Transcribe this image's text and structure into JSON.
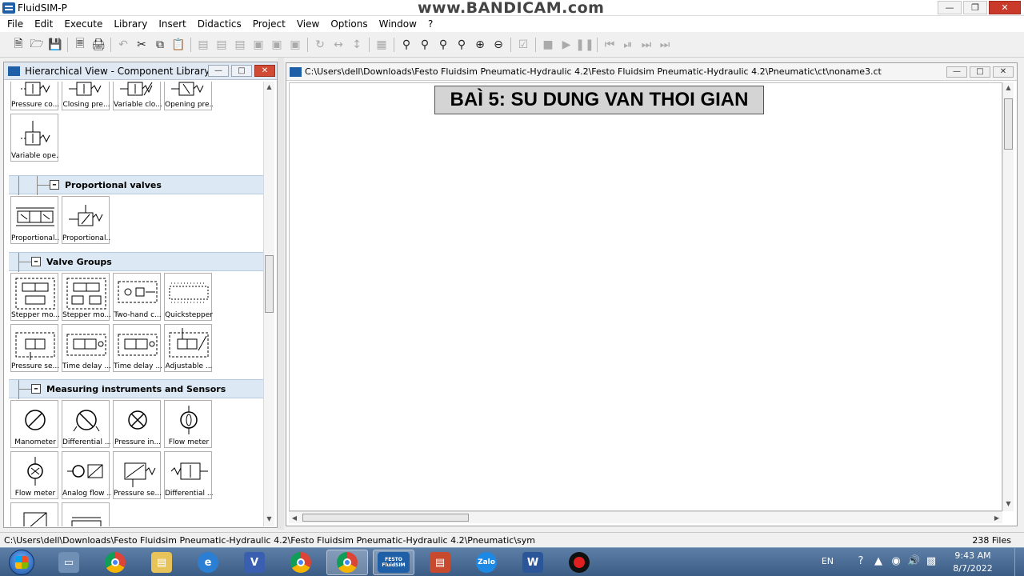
{
  "window": {
    "title": "FluidSIM-P",
    "watermark": "www.BANDICAM.com"
  },
  "menu": [
    "File",
    "Edit",
    "Execute",
    "Library",
    "Insert",
    "Didactics",
    "Project",
    "View",
    "Options",
    "Window",
    "?"
  ],
  "library": {
    "title": "Hierarchical View - Component Library",
    "top_items": [
      "Pressure co...",
      "Closing pre...",
      "Variable clo...",
      "Opening pre...",
      "Variable ope..."
    ],
    "categories": [
      {
        "label": "Proportional valves",
        "items": [
          "Proportional...",
          "Proportional..."
        ]
      },
      {
        "label": "Valve Groups",
        "items": [
          "Stepper mo...",
          "Stepper mo...",
          "Two-hand c...",
          "Quickstepper",
          "Pressure se...",
          "Time delay ...",
          "Time delay ...",
          "Adjustable ..."
        ]
      },
      {
        "label": "Measuring instruments and Sensors",
        "items": [
          "Manometer",
          "Differential ...",
          "Pressure in...",
          "Flow meter",
          "Flow meter",
          "Analog flow ...",
          "Pressure se...",
          "Differential ..."
        ]
      }
    ]
  },
  "circuit": {
    "path": "C:\\Users\\dell\\Downloads\\Festo Fluidsim Pneumatic-Hydraulic 4.2\\Festo Fluidsim Pneumatic-Hydraulic 4.2\\Pneumatic\\ct\\noname3.ct",
    "heading": "BAÌ 5: SU DUNG VAN THOI GIAN"
  },
  "status": {
    "path": "C:\\Users\\dell\\Downloads\\Festo Fluidsim Pneumatic-Hydraulic 4.2\\Festo Fluidsim Pneumatic-Hydraulic 4.2\\Pneumatic\\sym",
    "count": "238 Files"
  },
  "taskbar": {
    "lang": "EN",
    "time": "9:43 AM",
    "date": "8/7/2022",
    "fluidsim_label": "FESTO FluidSIM",
    "zalo_label": "Zalo"
  },
  "colors": {
    "accent": "#1f5fa8",
    "category_bg": "#dce9f5",
    "taskbar": "#3b5c84"
  }
}
